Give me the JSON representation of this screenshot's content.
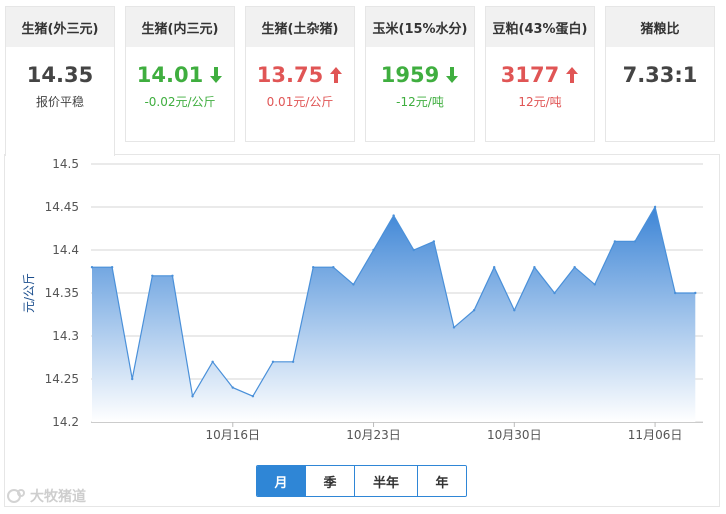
{
  "cards": [
    {
      "title": "生猪(外三元)",
      "price": "14.35",
      "sub": "报价平稳",
      "trend": "flat"
    },
    {
      "title": "生猪(内三元)",
      "price": "14.01",
      "sub": "-0.02元/公斤",
      "trend": "down"
    },
    {
      "title": "生猪(土杂猪)",
      "price": "13.75",
      "sub": "0.01元/公斤",
      "trend": "up"
    },
    {
      "title": "玉米(15%水分)",
      "price": "1959",
      "sub": "-12元/吨",
      "trend": "down"
    },
    {
      "title": "豆粕(43%蛋白)",
      "price": "3177",
      "sub": "12元/吨",
      "trend": "up"
    },
    {
      "title": "猪粮比",
      "price": "7.33:1",
      "sub": "",
      "trend": "none"
    }
  ],
  "colors": {
    "up": "#e05555",
    "down": "#3fae3f",
    "accent": "#2f86d6",
    "line": "#4a90d9"
  },
  "period_buttons": [
    "月",
    "季",
    "半年",
    "年"
  ],
  "active_period": "月",
  "watermark": "大牧猪道",
  "chart_data": {
    "type": "area",
    "ylabel": "元/公斤",
    "xlabel": "",
    "ylim": [
      14.2,
      14.5
    ],
    "yticks": [
      14.2,
      14.25,
      14.3,
      14.35,
      14.4,
      14.45,
      14.5
    ],
    "xticks": [
      {
        "index": 7,
        "label": "10月16日"
      },
      {
        "index": 14,
        "label": "10月23日"
      },
      {
        "index": 21,
        "label": "10月30日"
      },
      {
        "index": 28,
        "label": "11月06日"
      }
    ],
    "x": [
      "10月09日",
      "10月10日",
      "10月11日",
      "10月12日",
      "10月13日",
      "10月14日",
      "10月15日",
      "10月16日",
      "10月17日",
      "10月18日",
      "10月19日",
      "10月20日",
      "10月21日",
      "10月22日",
      "10月23日",
      "10月24日",
      "10月25日",
      "10月26日",
      "10月27日",
      "10月28日",
      "10月29日",
      "10月30日",
      "10月31日",
      "11月01日",
      "11月02日",
      "11月03日",
      "11月04日",
      "11月05日",
      "11月06日",
      "11月07日",
      "11月08日",
      "11月09日",
      "11月10日"
    ],
    "series": [
      {
        "values": [
          14.38,
          14.38,
          14.25,
          14.37,
          14.37,
          14.23,
          14.27,
          14.24,
          14.23,
          14.27,
          14.27,
          14.38,
          14.38,
          14.36,
          14.4,
          14.44,
          14.4,
          14.41,
          14.31,
          14.33,
          14.38,
          14.33,
          14.38,
          14.35,
          14.38,
          14.36,
          14.41,
          14.41,
          14.45,
          14.35,
          14.35
        ]
      }
    ],
    "grid": true
  }
}
